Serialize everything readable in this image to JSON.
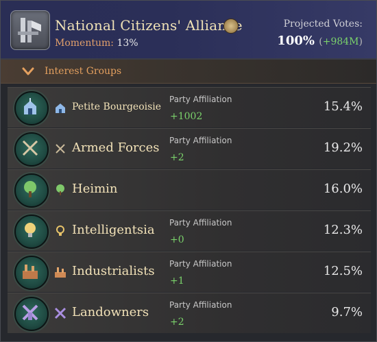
{
  "party": {
    "name": "National Citizens' Alliance",
    "momentum_label": "Momentum:",
    "momentum_value": "13%"
  },
  "votes": {
    "label": "Projected Votes:",
    "value": "100%",
    "change_open": "(",
    "change": "+984M",
    "change_close": ")"
  },
  "section": {
    "title": "Interest Groups"
  },
  "groups": [
    {
      "name": "Petite Bourgeoisie",
      "affiliation_label": "Party Affiliation",
      "affiliation": "+1002",
      "percent": "15.4%",
      "icon": "church-icon"
    },
    {
      "name": "Armed Forces",
      "affiliation_label": "Party Affiliation",
      "affiliation": "+2",
      "percent": "19.2%",
      "icon": "crossed-swords-icon"
    },
    {
      "name": "Heimin",
      "affiliation_label": "",
      "affiliation": "",
      "percent": "16.0%",
      "icon": "tree-icon"
    },
    {
      "name": "Intelligentsia",
      "affiliation_label": "Party Affiliation",
      "affiliation": "+0",
      "percent": "12.3%",
      "icon": "lightbulb-icon"
    },
    {
      "name": "Industrialists",
      "affiliation_label": "Party Affiliation",
      "affiliation": "+1",
      "percent": "12.5%",
      "icon": "factory-icon"
    },
    {
      "name": "Landowners",
      "affiliation_label": "Party Affiliation",
      "affiliation": "+2",
      "percent": "9.7%",
      "icon": "windmill-icon"
    }
  ],
  "colors": {
    "header_bg": "#2a2e55",
    "positive": "#7bd36b",
    "accent": "#e4a05f",
    "title": "#f0e2b6"
  }
}
